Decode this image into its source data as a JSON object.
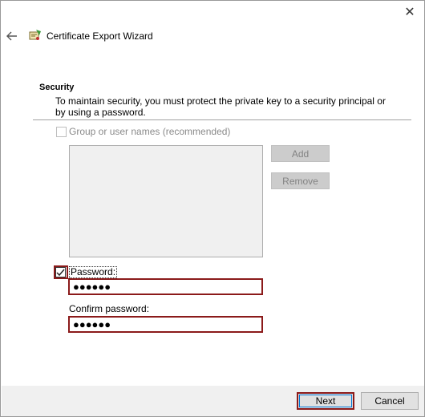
{
  "window": {
    "close_glyph": "✕",
    "back_icon": "back-arrow-icon",
    "title": "Certificate Export Wizard",
    "app_icon": "certificate-icon"
  },
  "security": {
    "title": "Security",
    "description": "To maintain security, you must protect the private key to a security principal or by using a password.",
    "group_checkbox_label": "Group or user names (recommended)",
    "group_checkbox_checked": false,
    "group_checkbox_enabled": false,
    "add_label": "Add",
    "remove_label": "Remove",
    "password_checkbox_label": "Password:",
    "password_checkbox_checked": true,
    "password_value": "●●●●●●",
    "confirm_label": "Confirm password:",
    "confirm_value": "●●●●●●"
  },
  "footer": {
    "next_label": "Next",
    "cancel_label": "Cancel"
  },
  "colors": {
    "highlight": "#8b1a1a",
    "footer_bg": "#f0f0f0",
    "disabled_text": "#838383"
  }
}
